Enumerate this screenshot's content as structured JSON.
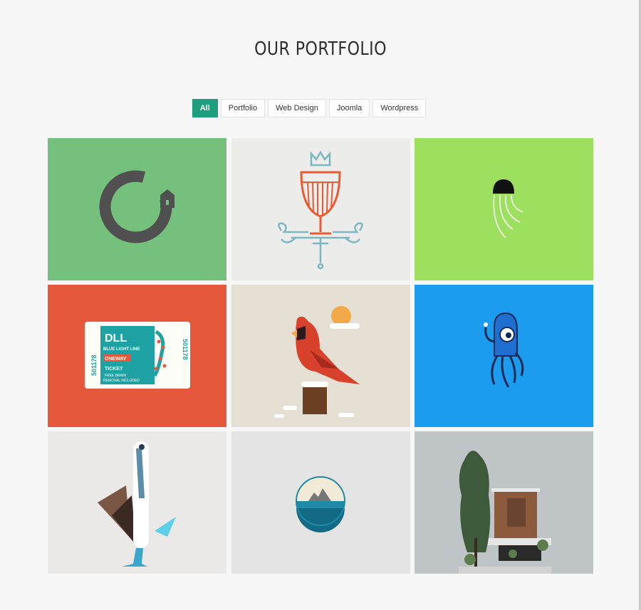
{
  "page": {
    "title": "OUR PORTFOLIO"
  },
  "filters": [
    {
      "label": "All",
      "active": true
    },
    {
      "label": "Portfolio",
      "active": false
    },
    {
      "label": "Web Design",
      "active": false
    },
    {
      "label": "Joomla",
      "active": false
    },
    {
      "label": "Wordpress",
      "active": false
    }
  ],
  "ticket": {
    "brand": "DLL",
    "line": "BLUE LIGHT LINE",
    "way": "ONEWAY",
    "kind": "TICKET",
    "note_1": "FREE BRAIN",
    "note_2": "REMOVAL INCLUDED",
    "serial_left": "501178",
    "serial_right": "501178"
  },
  "portfolio": {
    "items": [
      {
        "name": "ring-logo",
        "bg": "#74c07c"
      },
      {
        "name": "wine-glass",
        "bg": "#ececea"
      },
      {
        "name": "jellyfish",
        "bg": "#9ddf5f"
      },
      {
        "name": "ticket",
        "bg": "#e5583c"
      },
      {
        "name": "cardinal",
        "bg": "#e6dfd4"
      },
      {
        "name": "octopus",
        "bg": "#1b9cef"
      },
      {
        "name": "booby-bird",
        "bg": "#ebe8e8"
      },
      {
        "name": "island-circle",
        "bg": "#e4e4e4"
      },
      {
        "name": "modern-house",
        "bg": "#bfc4c7"
      }
    ]
  }
}
